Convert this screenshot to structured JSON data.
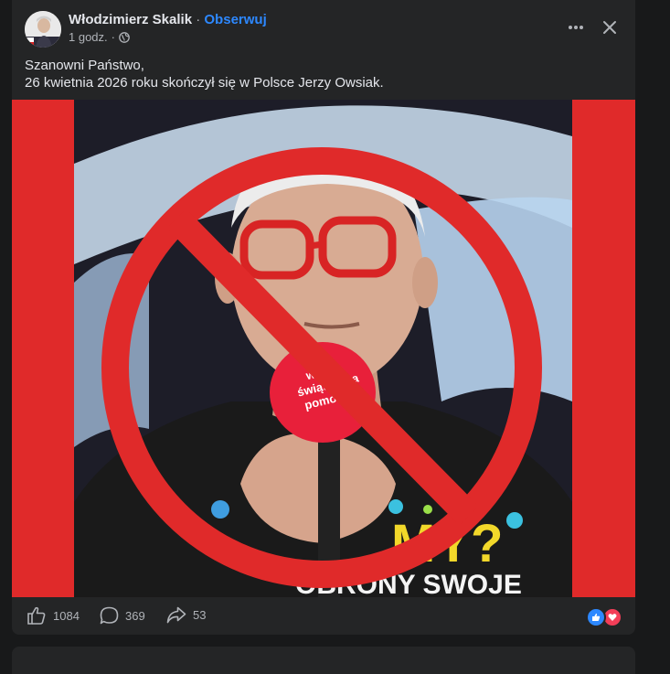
{
  "post": {
    "author": "Włodzimierz Skalik",
    "separator": "·",
    "follow_label": "Obserwuj",
    "time": "1 godz.",
    "time_separator": "·",
    "privacy_icon": "globe-icon",
    "text_lines": [
      "Szanowni Państwo,",
      "26 kwietnia 2026 roku skończył się w Polsce Jerzy Owsiak."
    ],
    "image": {
      "microphone_text_lines": [
        "wielka",
        "świąteczna",
        "pomocy"
      ],
      "shirt_text": "MY?",
      "shirt_text_2": "OBRONY SWOJE"
    },
    "actions": {
      "like_icon": "thumbs-up-icon",
      "like_count": "1084",
      "comment_icon": "comment-icon",
      "comment_count": "369",
      "share_icon": "share-icon",
      "share_count": "53"
    },
    "reaction_icons": [
      "like-reaction-icon",
      "love-reaction-icon"
    ],
    "colors": {
      "background": "#18191a",
      "card": "#242526",
      "link": "#2d88ff",
      "prohibition_red": "#e02a2a",
      "like_blue": "#2d88ff",
      "love_red": "#f33e58"
    }
  }
}
